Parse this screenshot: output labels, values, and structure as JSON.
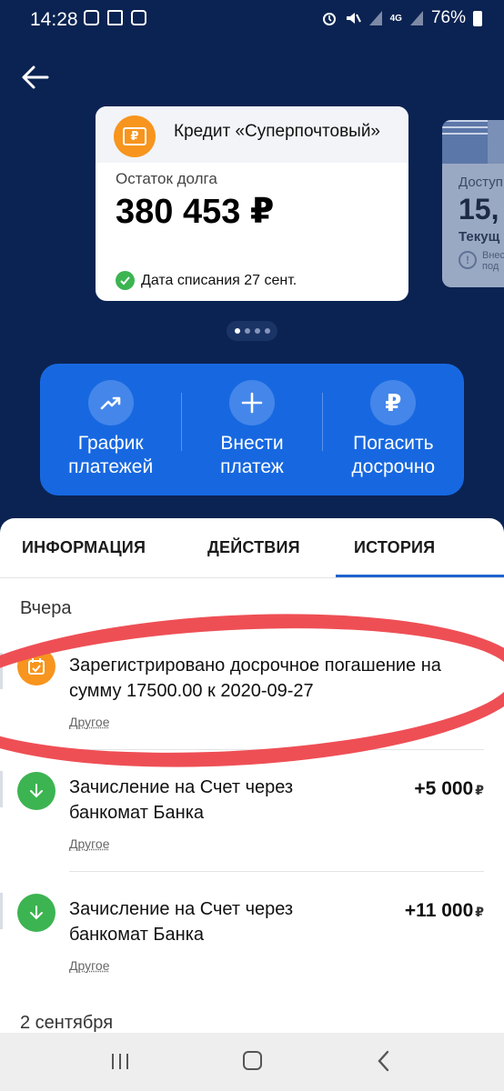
{
  "status_bar": {
    "time": "14:28",
    "battery": "76%",
    "network": "4G",
    "left_icons": [
      "instagram-icon",
      "app-icon",
      "square-app-icon"
    ],
    "right_icons": [
      "alarm-icon",
      "mute-icon",
      "signal-icon",
      "signal-icon",
      "battery-icon"
    ]
  },
  "header": {
    "back_icon": "back-arrow-icon"
  },
  "loan_card": {
    "title": "Кредит «Суперпочтовый»",
    "debt_label": "Остаток долга",
    "debt_amount": "380 453 ₽",
    "debit_date": "Дата списания 27 сент.",
    "icon": "ruble-card-icon"
  },
  "peek_card": {
    "label": "Доступ",
    "amount": "15,",
    "current": "Текущ",
    "note": "Внес\nпод"
  },
  "pager": {
    "count": 4,
    "active": 0
  },
  "actions": [
    {
      "label": "График\nплатежей",
      "icon": "trend-icon",
      "glyph": "↗"
    },
    {
      "label": "Внести\nплатеж",
      "icon": "plus-icon",
      "glyph": "+"
    },
    {
      "label": "Погасить\nдосрочно",
      "icon": "ruble-icon",
      "glyph": "₽"
    }
  ],
  "tabs": [
    {
      "label": "ИНФОРМАЦИЯ"
    },
    {
      "label": "ДЕЙСТВИЯ"
    },
    {
      "label": "ИСТОРИЯ",
      "active": true
    }
  ],
  "history": {
    "group1": "Вчера",
    "group2": "2 сентября",
    "items": [
      {
        "title": "Зарегистрировано досрочное погашение на сумму 17500.00 к 2020-09-27",
        "category": "Другое",
        "amount": "",
        "currency": "",
        "icon": "calendar-icon",
        "color": "#f7951e"
      },
      {
        "title": "Зачисление на Счет через банкомат Банка",
        "category": "Другое",
        "amount": "+5 000",
        "currency": "₽",
        "icon": "arrow-down-icon",
        "color": "#3cb451"
      },
      {
        "title": "Зачисление на Счет через банкомат Банка",
        "category": "Другое",
        "amount": "+11 000",
        "currency": "₽",
        "icon": "arrow-down-icon",
        "color": "#3cb451"
      }
    ]
  },
  "colors": {
    "background": "#0b2352",
    "action_panel": "#1768e0",
    "accent_tab": "#1f62d0",
    "annotation": "#ee4f55"
  }
}
